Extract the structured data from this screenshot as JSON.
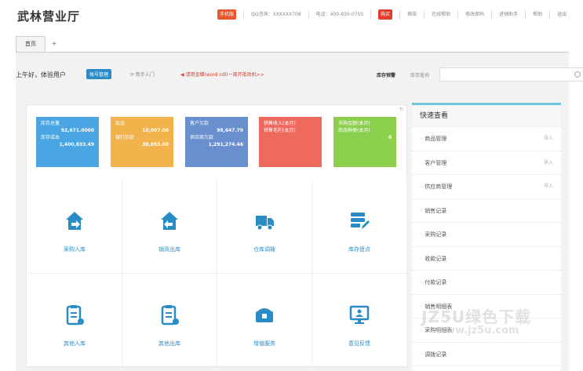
{
  "header": {
    "brand": "武林营业厅",
    "mobile_badge": "手机版",
    "qq": "QQ咨询：XXXXXX708",
    "phone": "电话：400-830-0755",
    "hot_badge": "购买",
    "links": [
      "换肤",
      "在线帮助",
      "修改密码",
      "进销助手",
      "帮助",
      "退出"
    ]
  },
  "tabs": {
    "home": "首页",
    "add": "+"
  },
  "greetbar": {
    "greeting": "上午好，体验用户",
    "manage_btn": "账号管理",
    "guide": "⟳ 新手入门",
    "notice": "◀ 请用金蝶(word cdl)一离开批改机>>",
    "inventory_label": "库存预警",
    "inventory_link": "库存查询",
    "search_placeholder": ""
  },
  "stats": [
    {
      "color": "#4aa6e2",
      "rows": [
        [
          "库存总量",
          ""
        ],
        [
          "",
          "92,671.0000"
        ],
        [
          "库存成本",
          ""
        ],
        [
          "",
          "1,400,833.49"
        ]
      ]
    },
    {
      "color": "#f2b24c",
      "rows": [
        [
          "现金",
          ""
        ],
        [
          "",
          "10,007.00"
        ],
        [
          "银行存款",
          ""
        ],
        [
          "",
          "38,053.00"
        ]
      ]
    },
    {
      "color": "#6a8fcf",
      "rows": [
        [
          "客户欠款",
          ""
        ],
        [
          "",
          "98,647.79"
        ],
        [
          "供应商欠款",
          ""
        ],
        [
          "",
          "1,291,274.46"
        ]
      ]
    },
    {
      "color": "#ee6a5e",
      "rows": [
        [
          "销售收入(本月)",
          ""
        ],
        [
          "销售毛利(本月)",
          ""
        ],
        [
          "",
          ""
        ],
        [
          "",
          ""
        ]
      ]
    },
    {
      "color": "#8ccf4d",
      "rows": [
        [
          "采购金额(本月)",
          ""
        ],
        [
          "商品种类(本月)",
          ""
        ],
        [
          "",
          "0"
        ],
        [
          "",
          ""
        ]
      ]
    }
  ],
  "grid_items": [
    {
      "label": "采购入库",
      "icon": "house-in-icon"
    },
    {
      "label": "销货出库",
      "icon": "house-out-icon"
    },
    {
      "label": "仓库调拨",
      "icon": "truck-icon"
    },
    {
      "label": "库存盘点",
      "icon": "stack-edit-icon"
    },
    {
      "label": "其他入库",
      "icon": "clipboard-in-icon"
    },
    {
      "label": "其他出库",
      "icon": "clipboard-out-icon"
    },
    {
      "label": "增值服务",
      "icon": "chest-icon"
    },
    {
      "label": "意见反馈",
      "icon": "monitor-icon"
    }
  ],
  "quick": {
    "title": "快速查看",
    "import_label": "导入",
    "items": [
      "商品管理",
      "客户管理",
      "供应商管理",
      "销售记录",
      "采购记录",
      "收款记录",
      "付款记录",
      "销售明细表",
      "采购明细表",
      "调拨记录"
    ]
  },
  "watermark": {
    "line1": "JZ5U绿色下载",
    "line2": "www.jz5u.com"
  }
}
